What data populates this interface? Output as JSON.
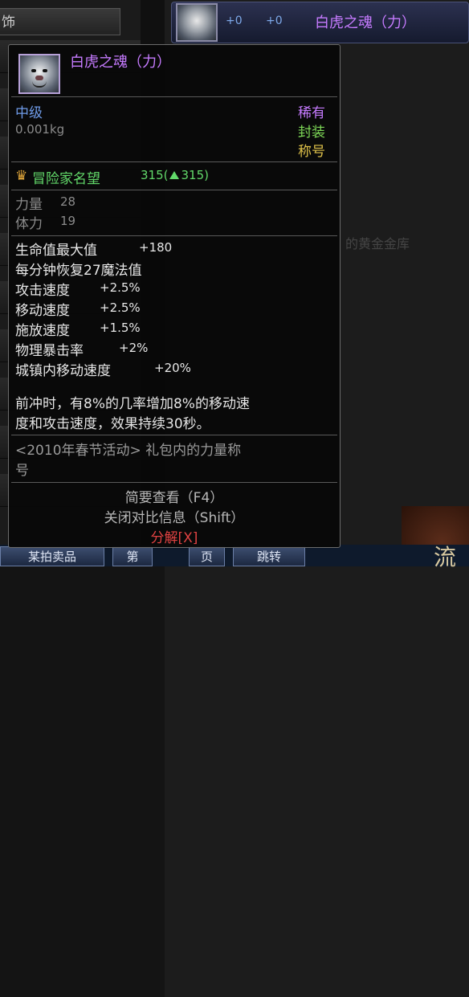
{
  "background": {
    "left_tab_label": "饰",
    "ghost_text_right": "的黄金金库",
    "bottom_buttons": [
      "某拍卖品",
      "第",
      "页",
      "跳转"
    ],
    "corner_glyph": "流"
  },
  "header": {
    "plus_a": "+0",
    "plus_b": "+0",
    "item_name": "白虎之魂（力）"
  },
  "tooltip": {
    "item_name": "白虎之魂（力）",
    "grade": "中级",
    "rarity": "稀有",
    "weight": "0.001kg",
    "sealed": "封装",
    "item_type": "称号",
    "reputation_label": "冒险家名望",
    "reputation_value": "315(",
    "reputation_delta": "315)",
    "base_stats": [
      {
        "name": "力量",
        "value": "28"
      },
      {
        "name": "体力",
        "value": "19"
      }
    ],
    "bonus_stats": [
      {
        "name": "生命值最大值",
        "value": "+180"
      },
      {
        "name": "每分钟恢复27魔法值",
        "value": ""
      },
      {
        "name": "攻击速度",
        "value": "+2.5%"
      },
      {
        "name": "移动速度",
        "value": "+2.5%"
      },
      {
        "name": "施放速度",
        "value": "+1.5%"
      },
      {
        "name": "物理暴击率",
        "value": "+2%"
      },
      {
        "name": "城镇内移动速度",
        "value": "+20%"
      }
    ],
    "effect_line1": "前冲时，有8%的几率增加8%的移动速",
    "effect_line2": "度和攻击速度，效果持续30秒。",
    "source_line1": "<2010年春节活动> 礼包内的力量称",
    "source_line2": "号",
    "action_brief": "简要查看（F4）",
    "action_compare": "关闭对比信息（Shift）",
    "action_disassemble": "分解[X]"
  },
  "colors": {
    "item_name": "#c67bff",
    "grade": "#6f9be8",
    "rarity": "#c67bff",
    "sealed": "#7ed957",
    "item_type": "#e0c24a",
    "reputation": "#62d96a",
    "stat_gray": "#8b8b8b",
    "stat_white": "#e8e8e8",
    "effect": "#e6e6e6",
    "source": "#9a9a9a",
    "action": "#b8b8b8",
    "disassemble": "#e04242"
  }
}
